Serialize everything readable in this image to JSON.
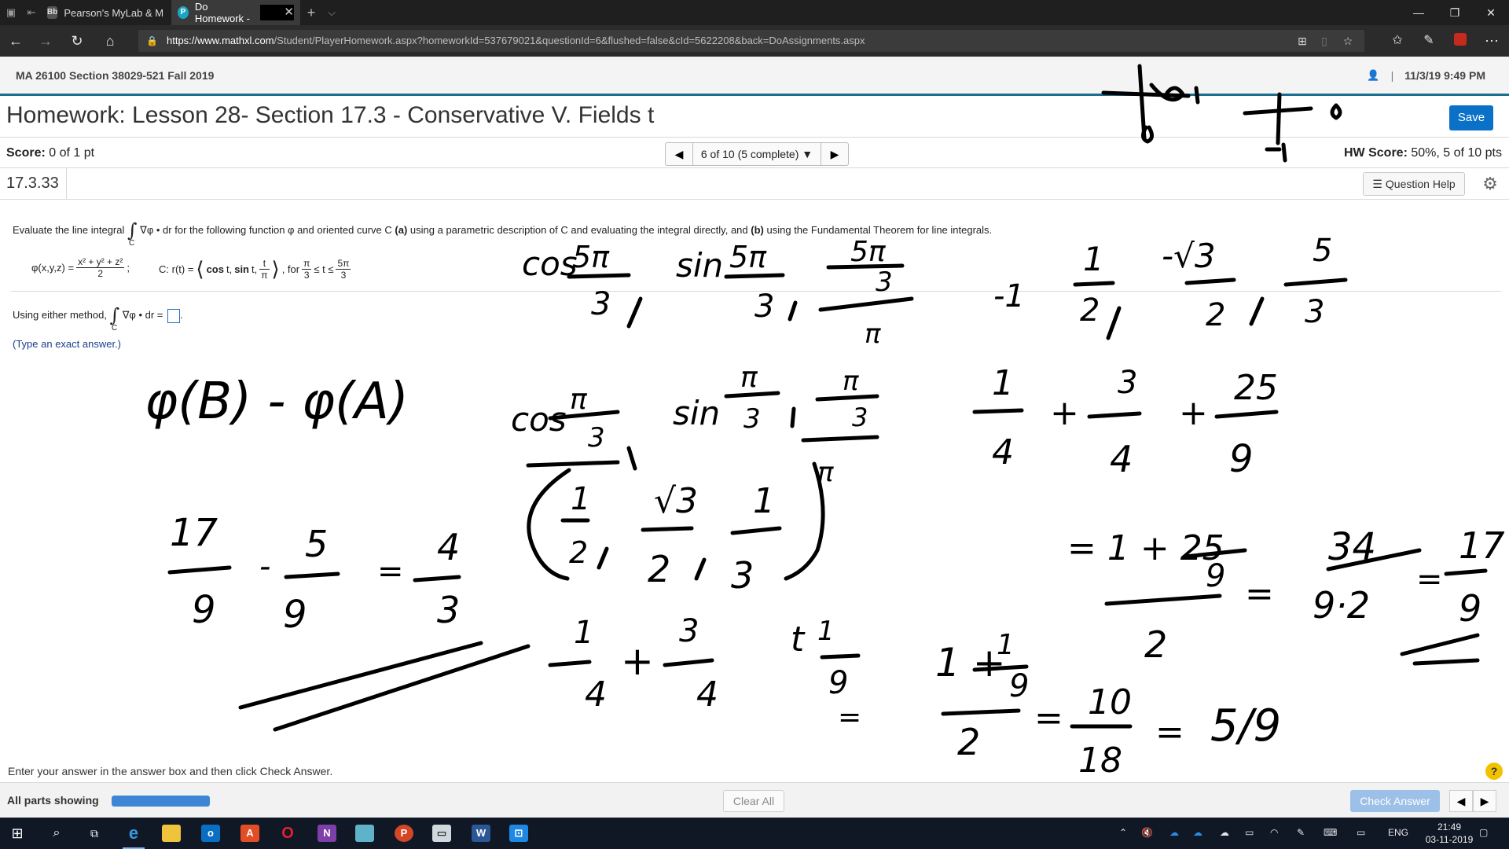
{
  "browser": {
    "tabs": [
      {
        "label": "Pearson's MyLab & Masterii",
        "favicon": "Bb",
        "active": false
      },
      {
        "label": "Do Homework -",
        "favicon": "P",
        "active": true
      }
    ],
    "url_host": "https://www.mathxl.com",
    "url_path": "/Student/PlayerHomework.aspx?homeworkId=537679021&questionId=6&flushed=false&cId=5622208&back=DoAssignments.aspx"
  },
  "course": {
    "title": "MA 26100 Section 38029-521 Fall 2019",
    "separator": "|",
    "datetime": "11/3/19 9:49 PM"
  },
  "homework": {
    "title": "Homework: Lesson 28- Section 17.3 - Conservative V. Fields t",
    "save_label": "Save",
    "score_label": "Score:",
    "score_value": "0 of 1 pt",
    "question_selector": "6 of 10 (5 complete)",
    "hw_score_label": "HW Score:",
    "hw_score_value": "50%, 5 of 10 pts",
    "question_number": "17.3.33",
    "question_help_label": "Question Help"
  },
  "question": {
    "prompt_start": "Evaluate the line integral",
    "integral_symbol": "∫",
    "integral_sub": "C",
    "integrand": "∇φ • dr",
    "prompt_rest": "for the following function φ and oriented curve C",
    "part_a_label": "(a)",
    "part_a_text": "using a parametric description of C and evaluating the integral directly, and",
    "part_b_label": "(b)",
    "part_b_text": "using the Fundamental Theorem for line integrals.",
    "phi_lhs": "φ(x,y,z) =",
    "phi_num": "x² + y² + z²",
    "phi_den": "2",
    "phi_end": ";",
    "curve_lhs": "C: r(t) =",
    "curve_open": "⟨",
    "curve_cos": "cos",
    "curve_t1": "t,",
    "curve_sin": "sin",
    "curve_t2": "t,",
    "curve_frac_num": "t",
    "curve_frac_den": "π",
    "curve_close": "⟩",
    "curve_for": ", for",
    "range_low_num": "π",
    "range_low_den": "3",
    "range_mid": "≤ t ≤",
    "range_high_num": "5π",
    "range_high_den": "3",
    "answer_prompt": "Using either method,",
    "answer_integrand": "∇φ • dr =",
    "answer_end": ".",
    "hint": "(Type an exact answer.)"
  },
  "footer": {
    "instructions": "Enter your answer in the answer box and then click Check Answer.",
    "help_symbol": "?",
    "parts_label": "All parts showing",
    "progress_fraction": 1.0,
    "clear_label": "Clear All",
    "check_label": "Check Answer"
  },
  "taskbar": {
    "language": "ENG",
    "time": "21:49",
    "date": "03-11-2019"
  },
  "ink_text": [
    "cos 5π/3",
    "sin 5π/3",
    "5π/3 / π",
    "-1",
    "1/2",
    "-√3/2",
    "5/3",
    "φ(B) - φ(A)",
    "cos π/3",
    "sin π/3",
    "π/3 / π",
    "(1/2, √3/2, 1/3)",
    "1/4 + 3/4 + 25/9",
    "= 1 + 25/9 / 2",
    "= 34/9·2",
    "= 17/9",
    "17/9 - 5/9 = 4/3",
    "1/4 + 3/4",
    "t/π",
    "1/9",
    "1 + 1/9 / 2",
    "= 10/18",
    "= 5/9",
    "π/5",
    "1",
    "0",
    "-1"
  ],
  "icons": {
    "back": "arrow-left",
    "forward": "arrow-right",
    "refresh": "refresh",
    "home": "home",
    "lock": "lock",
    "favorite": "star",
    "settings": "gear",
    "help": "question"
  },
  "colors": {
    "brand_blue": "#0b71c8",
    "rule_teal": "#1a6e8e",
    "check_disabled": "#9cc0e8",
    "progress": "#3d86d6"
  }
}
